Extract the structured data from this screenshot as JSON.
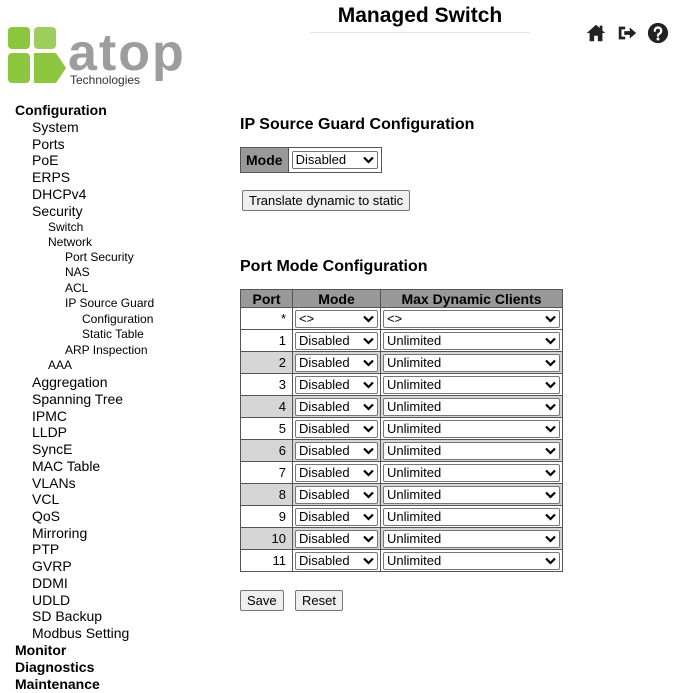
{
  "header": {
    "logo_text": "atop",
    "logo_subtext": "Technologies",
    "title": "Managed Switch",
    "icons": [
      "home-icon",
      "logout-icon",
      "help-icon"
    ]
  },
  "sidebar": {
    "items": [
      {
        "label": "Configuration",
        "level": 0
      },
      {
        "label": "System",
        "level": 1
      },
      {
        "label": "Ports",
        "level": 1
      },
      {
        "label": "PoE",
        "level": 1
      },
      {
        "label": "ERPS",
        "level": 1
      },
      {
        "label": "DHCPv4",
        "level": 1
      },
      {
        "label": "Security",
        "level": 1
      },
      {
        "label": "Switch",
        "level": 2
      },
      {
        "label": "Network",
        "level": 2
      },
      {
        "label": "Port Security",
        "level": 3
      },
      {
        "label": "NAS",
        "level": 3
      },
      {
        "label": "ACL",
        "level": 3
      },
      {
        "label": "IP Source Guard",
        "level": 3
      },
      {
        "label": "Configuration",
        "level": 4
      },
      {
        "label": "Static Table",
        "level": 4
      },
      {
        "label": "ARP Inspection",
        "level": 3
      },
      {
        "label": "AAA",
        "level": 2
      },
      {
        "label": "Aggregation",
        "level": 1
      },
      {
        "label": "Spanning Tree",
        "level": 1
      },
      {
        "label": "IPMC",
        "level": 1
      },
      {
        "label": "LLDP",
        "level": 1
      },
      {
        "label": "SyncE",
        "level": 1
      },
      {
        "label": "MAC Table",
        "level": 1
      },
      {
        "label": "VLANs",
        "level": 1
      },
      {
        "label": "VCL",
        "level": 1
      },
      {
        "label": "QoS",
        "level": 1
      },
      {
        "label": "Mirroring",
        "level": 1
      },
      {
        "label": "PTP",
        "level": 1
      },
      {
        "label": "GVRP",
        "level": 1
      },
      {
        "label": "DDMI",
        "level": 1
      },
      {
        "label": "UDLD",
        "level": 1
      },
      {
        "label": "SD Backup",
        "level": 1
      },
      {
        "label": "Modbus Setting",
        "level": 1
      },
      {
        "label": "Monitor",
        "level": 0
      },
      {
        "label": "Diagnostics",
        "level": 0
      },
      {
        "label": "Maintenance",
        "level": 0
      }
    ]
  },
  "main": {
    "title": "IP Source Guard Configuration",
    "mode_label": "Mode",
    "mode_value": "Disabled",
    "translate_button": "Translate dynamic to static",
    "port_section_title": "Port Mode Configuration",
    "columns": [
      "Port",
      "Mode",
      "Max Dynamic Clients"
    ],
    "wildcard_row": {
      "port": "*",
      "mode": "<>",
      "max": "<>"
    },
    "rows": [
      {
        "port": "1",
        "mode": "Disabled",
        "max": "Unlimited"
      },
      {
        "port": "2",
        "mode": "Disabled",
        "max": "Unlimited"
      },
      {
        "port": "3",
        "mode": "Disabled",
        "max": "Unlimited"
      },
      {
        "port": "4",
        "mode": "Disabled",
        "max": "Unlimited"
      },
      {
        "port": "5",
        "mode": "Disabled",
        "max": "Unlimited"
      },
      {
        "port": "6",
        "mode": "Disabled",
        "max": "Unlimited"
      },
      {
        "port": "7",
        "mode": "Disabled",
        "max": "Unlimited"
      },
      {
        "port": "8",
        "mode": "Disabled",
        "max": "Unlimited"
      },
      {
        "port": "9",
        "mode": "Disabled",
        "max": "Unlimited"
      },
      {
        "port": "10",
        "mode": "Disabled",
        "max": "Unlimited"
      },
      {
        "port": "11",
        "mode": "Disabled",
        "max": "Unlimited"
      }
    ],
    "save_button": "Save",
    "reset_button": "Reset"
  },
  "colors": {
    "logo_green": "#8dc63f",
    "logo_gray": "#9d9d9d",
    "header_cell_gray": "#999999",
    "row_alt_gray": "#d6d6d6"
  }
}
